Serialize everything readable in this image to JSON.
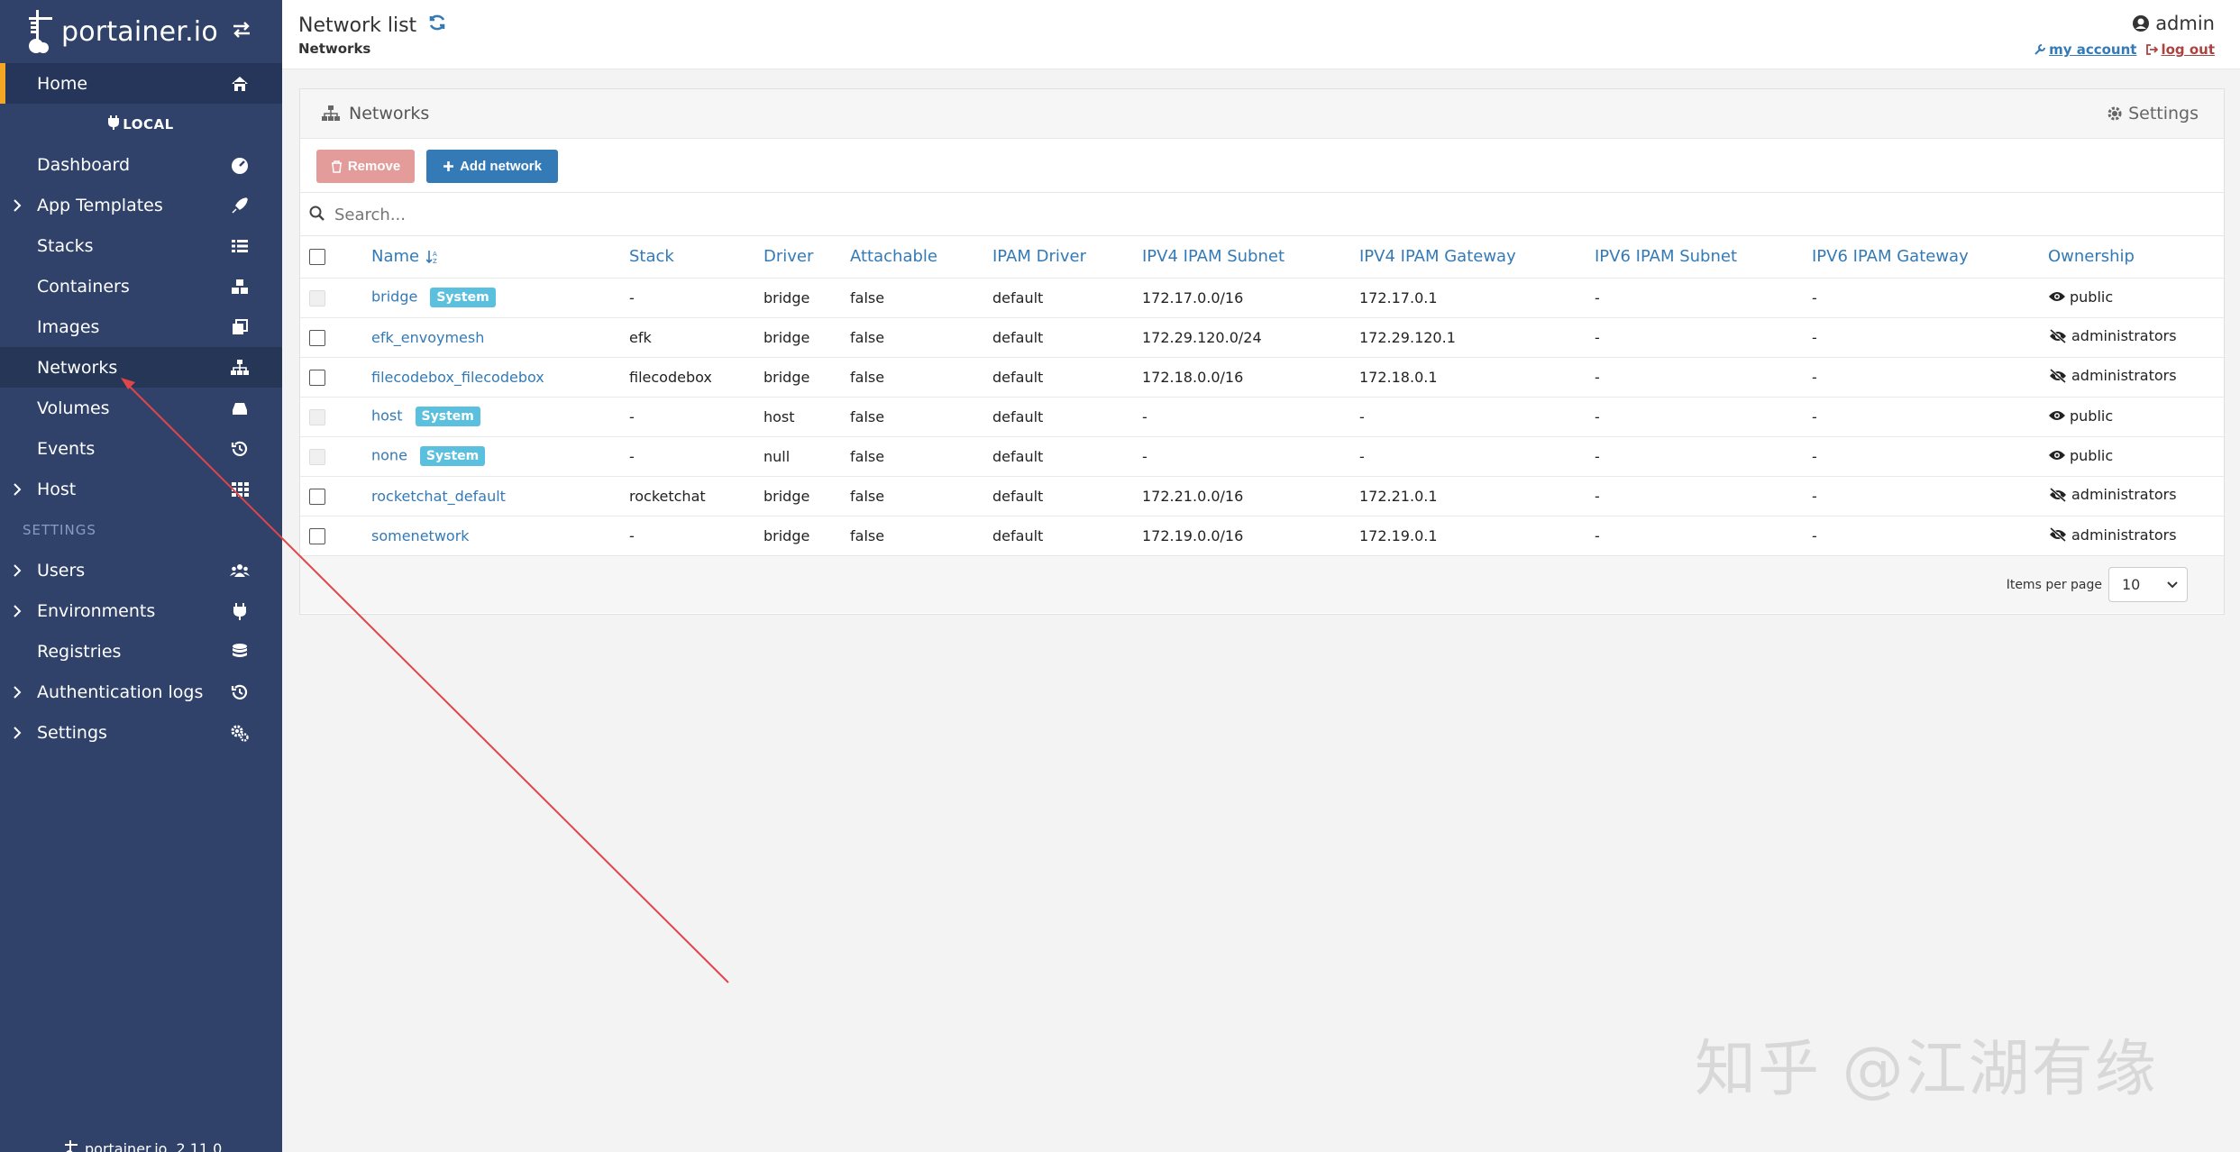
{
  "brand": {
    "name": "portainer.io",
    "version": "2.11.0"
  },
  "sidebar": {
    "home": "Home",
    "endpoint": "LOCAL",
    "items": [
      {
        "label": "Dashboard",
        "icon": "tachometer-icon",
        "expandable": false
      },
      {
        "label": "App Templates",
        "icon": "rocket-icon",
        "expandable": true
      },
      {
        "label": "Stacks",
        "icon": "th-list-icon",
        "expandable": false
      },
      {
        "label": "Containers",
        "icon": "cubes-icon",
        "expandable": false
      },
      {
        "label": "Images",
        "icon": "clone-icon",
        "expandable": false
      },
      {
        "label": "Networks",
        "icon": "sitemap-icon",
        "expandable": false
      },
      {
        "label": "Volumes",
        "icon": "hdd-icon",
        "expandable": false
      },
      {
        "label": "Events",
        "icon": "history-icon",
        "expandable": false
      },
      {
        "label": "Host",
        "icon": "th-icon",
        "expandable": true
      }
    ],
    "settings_title": "SETTINGS",
    "settings_items": [
      {
        "label": "Users",
        "icon": "users-icon",
        "expandable": true
      },
      {
        "label": "Environments",
        "icon": "plug-icon",
        "expandable": true
      },
      {
        "label": "Registries",
        "icon": "database-icon",
        "expandable": false
      },
      {
        "label": "Authentication logs",
        "icon": "history-icon",
        "expandable": true
      },
      {
        "label": "Settings",
        "icon": "cogs-icon",
        "expandable": true
      }
    ]
  },
  "header": {
    "title": "Network list",
    "breadcrumb": "Networks",
    "username": "admin",
    "my_account": "my account",
    "log_out": "log out"
  },
  "widget": {
    "title": "Networks",
    "settings": "Settings",
    "remove_label": "Remove",
    "add_label": "Add network",
    "search_placeholder": "Search...",
    "columns": [
      "Name",
      "Stack",
      "Driver",
      "Attachable",
      "IPAM Driver",
      "IPV4 IPAM Subnet",
      "IPV4 IPAM Gateway",
      "IPV6 IPAM Subnet",
      "IPV6 IPAM Gateway",
      "Ownership"
    ],
    "system_badge": "System",
    "rows": [
      {
        "name": "bridge",
        "system": true,
        "stack": "-",
        "driver": "bridge",
        "attachable": "false",
        "ipam_driver": "default",
        "v4_subnet": "172.17.0.0/16",
        "v4_gateway": "172.17.0.1",
        "v6_subnet": "-",
        "v6_gateway": "-",
        "ownership": "public"
      },
      {
        "name": "efk_envoymesh",
        "system": false,
        "stack": "efk",
        "driver": "bridge",
        "attachable": "false",
        "ipam_driver": "default",
        "v4_subnet": "172.29.120.0/24",
        "v4_gateway": "172.29.120.1",
        "v6_subnet": "-",
        "v6_gateway": "-",
        "ownership": "administrators"
      },
      {
        "name": "filecodebox_filecodebox",
        "system": false,
        "stack": "filecodebox",
        "driver": "bridge",
        "attachable": "false",
        "ipam_driver": "default",
        "v4_subnet": "172.18.0.0/16",
        "v4_gateway": "172.18.0.1",
        "v6_subnet": "-",
        "v6_gateway": "-",
        "ownership": "administrators"
      },
      {
        "name": "host",
        "system": true,
        "stack": "-",
        "driver": "host",
        "attachable": "false",
        "ipam_driver": "default",
        "v4_subnet": "-",
        "v4_gateway": "-",
        "v6_subnet": "-",
        "v6_gateway": "-",
        "ownership": "public"
      },
      {
        "name": "none",
        "system": true,
        "stack": "-",
        "driver": "null",
        "attachable": "false",
        "ipam_driver": "default",
        "v4_subnet": "-",
        "v4_gateway": "-",
        "v6_subnet": "-",
        "v6_gateway": "-",
        "ownership": "public"
      },
      {
        "name": "rocketchat_default",
        "system": false,
        "stack": "rocketchat",
        "driver": "bridge",
        "attachable": "false",
        "ipam_driver": "default",
        "v4_subnet": "172.21.0.0/16",
        "v4_gateway": "172.21.0.1",
        "v6_subnet": "-",
        "v6_gateway": "-",
        "ownership": "administrators"
      },
      {
        "name": "somenetwork",
        "system": false,
        "stack": "-",
        "driver": "bridge",
        "attachable": "false",
        "ipam_driver": "default",
        "v4_subnet": "172.19.0.0/16",
        "v4_gateway": "172.19.0.1",
        "v6_subnet": "-",
        "v6_gateway": "-",
        "ownership": "administrators"
      }
    ],
    "items_per_page_label": "Items per page",
    "items_per_page_value": "10"
  },
  "watermark": "知乎 @江湖有缘",
  "colors": {
    "sidebar": "#30426a",
    "accent": "#f5a623",
    "link": "#337ab7",
    "badge": "#5bc0de",
    "arrow": "#e0454a"
  }
}
